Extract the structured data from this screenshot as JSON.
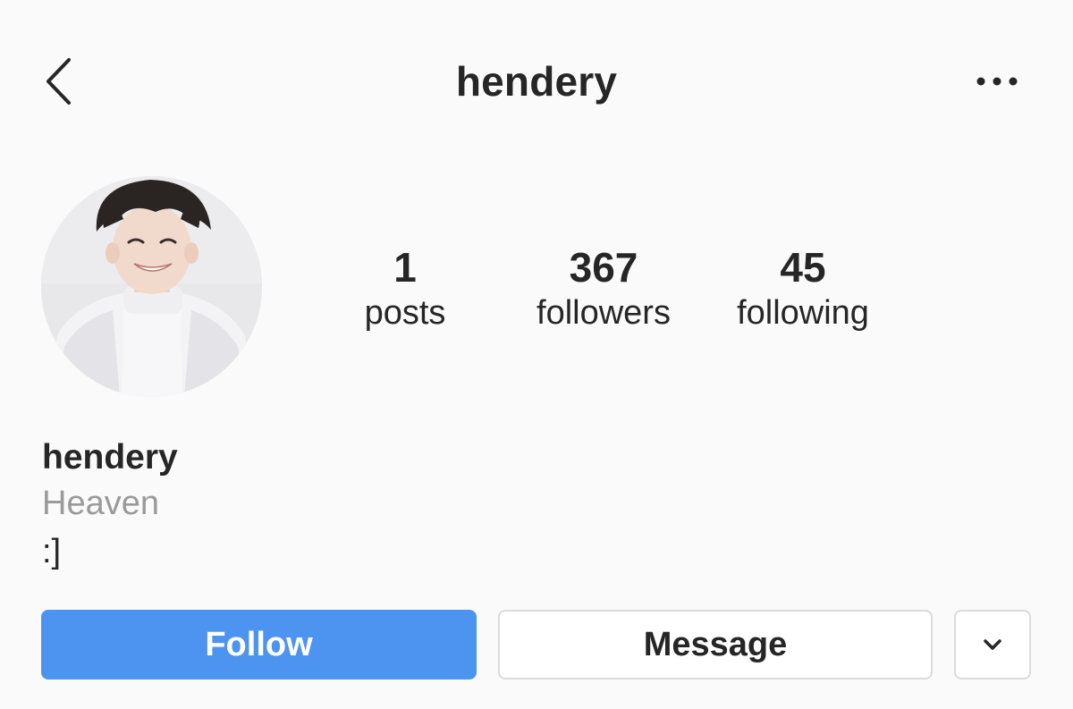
{
  "header": {
    "title": "hendery",
    "back_icon": "chevron-left-icon",
    "more_icon": "more-horizontal-icon"
  },
  "profile": {
    "avatar": "profile-photo",
    "stats": [
      {
        "count": "1",
        "label": "posts"
      },
      {
        "count": "367",
        "label": "followers"
      },
      {
        "count": "45",
        "label": "following"
      }
    ],
    "display_name": "hendery",
    "category": "Heaven",
    "bio": ":]"
  },
  "actions": {
    "follow_label": "Follow",
    "message_label": "Message",
    "dropdown_icon": "chevron-down-icon"
  },
  "colors": {
    "background": "#fafafa",
    "text": "#262626",
    "secondary_text": "#9a9a9a",
    "follow_button": "#4c94f0",
    "button_border": "#dbdbdb"
  }
}
